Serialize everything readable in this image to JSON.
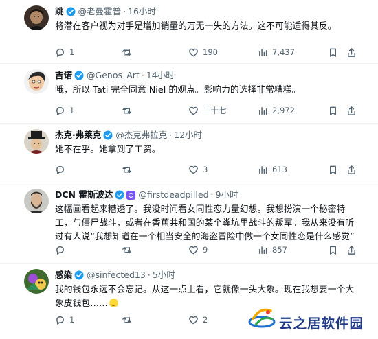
{
  "tweets": [
    {
      "name": "跳",
      "handle": "@老曼霍普",
      "time": "16小时",
      "lines": [
        "将潜在客户视为对手是增加销量的万无一失的方法。这不可能适得其反。"
      ],
      "replies": "1",
      "retweets": "",
      "likes": "190",
      "views": "7,437",
      "avatar_icon": "portrait-avatar"
    },
    {
      "name": "吉诺",
      "handle": "@Genos_Art",
      "time": "14小时",
      "lines": [
        "哦，所以 Tati 完全同意 Niel 的观点。影响力的选择非常糟糕。"
      ],
      "replies": "1",
      "retweets": "",
      "likes": "二十七",
      "views": "2,972",
      "avatar_icon": "cartoon-avatar"
    },
    {
      "name": "杰克·弗莱克",
      "handle": "@杰克弗拉克",
      "time": "12小时",
      "lines": [
        "她不在乎。她拿到了工资。"
      ],
      "replies": "",
      "retweets": "",
      "likes": "3",
      "views": "613",
      "avatar_icon": "top-hat-avatar"
    },
    {
      "name": "DCN 霍斯波达",
      "handle": "@firstdeadpilled",
      "time": "9小时",
      "lines": [
        "这幅画看起来糟透了。我没时间看女同性恋力量幻想。我想扮演一个秘密特",
        "工，与僵尸战斗，或者在香蕉共和国的某个粪坑里战斗的叛军。我从来没有听",
        "过有人说“我想知道在一个相当安全的海盗冒险中做一个女同性恋是什么感觉”"
      ],
      "replies": "",
      "retweets": "",
      "likes": "9",
      "views": "857",
      "avatar_icon": "bearded-avatar"
    },
    {
      "name": "感染",
      "handle": "@sinfected13",
      "time": "5小时",
      "lines": [
        "我的钱包永远不会忘记。从这一点上看，它就像一头大象。现在我想要一个大",
        "象皮钱包……"
      ],
      "replies": "1",
      "retweets": "",
      "likes": "2",
      "views": "",
      "avatar_icon": "game-art-avatar"
    }
  ],
  "watermark": {
    "text": "云之居软件园"
  },
  "colors": {
    "verified": "#1d9bf0",
    "muted": "#536471",
    "text": "#0f1419",
    "divider": "#eff3f4",
    "watermark": "#1f3b87"
  }
}
